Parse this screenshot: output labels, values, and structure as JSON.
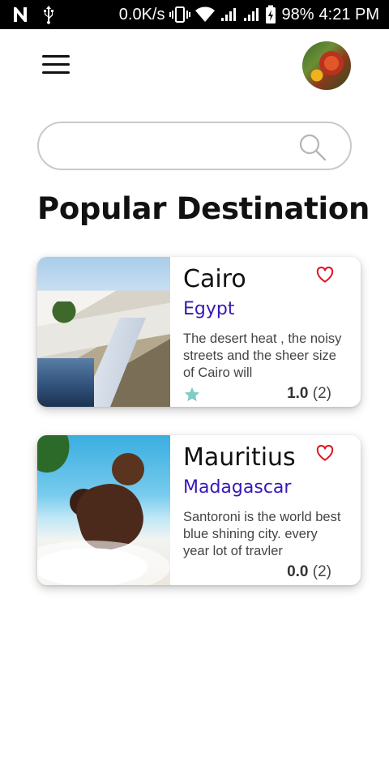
{
  "status_bar": {
    "network_speed": "0.0K/s",
    "battery": "98%",
    "time": "4:21 PM"
  },
  "search": {
    "placeholder": "",
    "value": ""
  },
  "heading": "Popular Destination",
  "destinations": [
    {
      "title": "Cairo",
      "country": "Egypt",
      "description": "The desert heat , the noisy streets and the sheer size of Cairo will",
      "rating": "1.0",
      "reviews": "(2)",
      "show_star": true
    },
    {
      "title": "Mauritius",
      "country": "Madagascar",
      "description": "Santoroni is the world best blue shining city. every year lot of travler",
      "rating": "0.0",
      "reviews": "(2)",
      "show_star": false
    }
  ],
  "colors": {
    "accent_purple": "#3a16b8",
    "heart_red": "#e0141e",
    "star_teal": "#80cbc4"
  },
  "icons": [
    "menu-icon",
    "search-icon",
    "heart-icon",
    "star-icon",
    "avatar"
  ]
}
